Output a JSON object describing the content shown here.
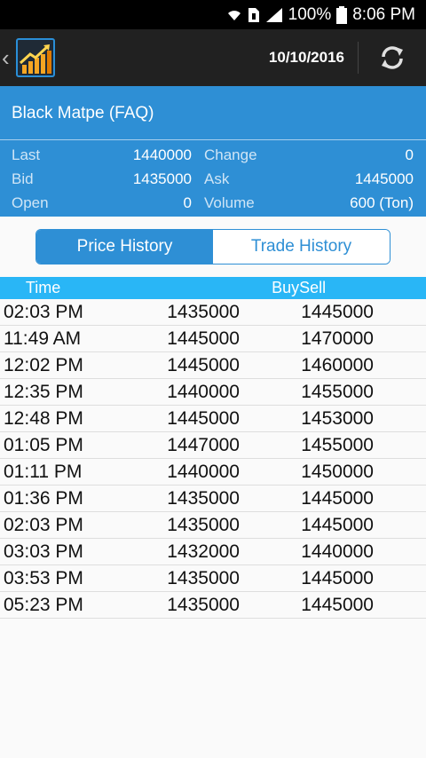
{
  "status": {
    "battery_text": "100%",
    "time": "8:06 PM"
  },
  "appbar": {
    "back_icon": "chevron-left-icon",
    "logo_icon": "chart-logo-icon",
    "date": "10/10/2016",
    "refresh_icon": "refresh-icon"
  },
  "header": {
    "name": "Black Matpe (FAQ)"
  },
  "quote": {
    "last_label": "Last",
    "last_value": "1440000",
    "change_label": "Change",
    "change_value": "0",
    "bid_label": "Bid",
    "bid_value": "1435000",
    "ask_label": "Ask",
    "ask_value": "1445000",
    "open_label": "Open",
    "open_value": "0",
    "volume_label": "Volume",
    "volume_value": "600 (Ton)"
  },
  "tabs": {
    "price_history": "Price History",
    "trade_history": "Trade History"
  },
  "table": {
    "headers": {
      "time": "Time",
      "buy": "Buy",
      "sell": "Sell"
    },
    "rows": [
      {
        "time": "02:03 PM",
        "buy": "1435000",
        "sell": "1445000"
      },
      {
        "time": "11:49 AM",
        "buy": "1445000",
        "sell": "1470000"
      },
      {
        "time": "12:02 PM",
        "buy": "1445000",
        "sell": "1460000"
      },
      {
        "time": "12:35 PM",
        "buy": "1440000",
        "sell": "1455000"
      },
      {
        "time": "12:48 PM",
        "buy": "1445000",
        "sell": "1453000"
      },
      {
        "time": "01:05 PM",
        "buy": "1447000",
        "sell": "1455000"
      },
      {
        "time": "01:11 PM",
        "buy": "1440000",
        "sell": "1450000"
      },
      {
        "time": "01:36 PM",
        "buy": "1435000",
        "sell": "1445000"
      },
      {
        "time": "02:03 PM",
        "buy": "1435000",
        "sell": "1445000"
      },
      {
        "time": "03:03 PM",
        "buy": "1432000",
        "sell": "1440000"
      },
      {
        "time": "03:53 PM",
        "buy": "1435000",
        "sell": "1445000"
      },
      {
        "time": "05:23 PM",
        "buy": "1435000",
        "sell": "1445000"
      }
    ]
  },
  "colors": {
    "primary": "#2e8fd5",
    "table_header": "#29b6f6",
    "appbar": "#212121"
  }
}
